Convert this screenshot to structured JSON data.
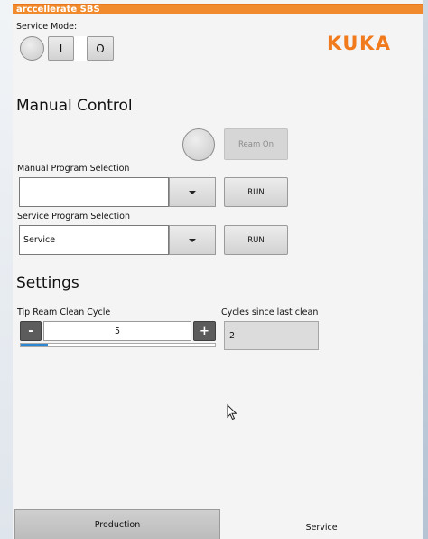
{
  "window": {
    "title": "arccellerate SBS"
  },
  "brand": {
    "logo_text": "KUKA",
    "accent": "#f07a1c"
  },
  "service_mode": {
    "label": "Service Mode:",
    "on_label": "I",
    "off_label": "O",
    "indicator_icon": "circle-indicator"
  },
  "manual_control": {
    "heading": "Manual Control",
    "ream_on_label": "Ream On",
    "manual_program": {
      "label": "Manual Program Selection",
      "value": "",
      "run_label": "RUN"
    },
    "service_program": {
      "label": "Service Program Selection",
      "value": "Service",
      "run_label": "RUN"
    }
  },
  "settings": {
    "heading": "Settings",
    "tip_ream": {
      "label": "Tip Ream Clean Cycle",
      "minus_label": "-",
      "plus_label": "+",
      "value": "5",
      "progress_fraction": 0.14
    },
    "cycles_since_last_clean": {
      "label": "Cycles since last clean",
      "value": "2"
    }
  },
  "tabs": [
    {
      "label": "Production",
      "active": false
    },
    {
      "label": "Service",
      "active": true
    }
  ]
}
